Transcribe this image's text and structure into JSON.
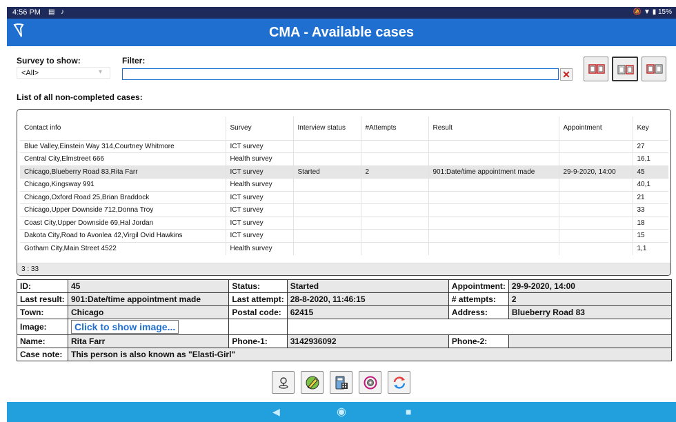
{
  "status_bar": {
    "time": "4:56 PM",
    "icons": [
      "gallery-icon",
      "music-icon"
    ],
    "right": "🔕 ▼ ▮ 15%"
  },
  "header": {
    "title": "CMA - Available cases"
  },
  "survey": {
    "label": "Survey to show:",
    "selected": "<All>"
  },
  "filter": {
    "label": "Filter:",
    "value": "",
    "clear_label": "✕"
  },
  "list": {
    "title": "List of all non-completed cases:",
    "columns": [
      "Contact info",
      "Survey",
      "Interview status",
      "#Attempts",
      "Result",
      "Appointment",
      "Key"
    ],
    "rows": [
      [
        "Blue Valley,Einstein Way 314,Courtney Whitmore",
        "ICT survey",
        "",
        "",
        "",
        "",
        "27"
      ],
      [
        "Central City,Elmstreet 666",
        "Health survey",
        "",
        "",
        "",
        "",
        "16,1"
      ],
      [
        "Chicago,Blueberry Road 83,Rita Farr",
        "ICT survey",
        "Started",
        "2",
        "901:Date/time appointment made",
        "29-9-2020, 14:00",
        "45"
      ],
      [
        "Chicago,Kingsway 991",
        "Health survey",
        "",
        "",
        "",
        "",
        "40,1"
      ],
      [
        "Chicago,Oxford Road 25,Brian Braddock",
        "ICT survey",
        "",
        "",
        "",
        "",
        "21"
      ],
      [
        "Chicago,Upper Downside 712,Donna Troy",
        "ICT survey",
        "",
        "",
        "",
        "",
        "33"
      ],
      [
        "Coast City,Upper Downside 69,Hal Jordan",
        "ICT survey",
        "",
        "",
        "",
        "",
        "18"
      ],
      [
        "Dakota City,Road to Avonlea 42,Virgil Ovid Hawkins",
        "ICT survey",
        "",
        "",
        "",
        "",
        "15"
      ],
      [
        "Gotham City,Main Street 4522",
        "Health survey",
        "",
        "",
        "",
        "",
        "1,1"
      ]
    ],
    "selected_row": 2,
    "count": "3 : 33"
  },
  "details": {
    "id_label": "ID:",
    "id": "45",
    "status_label": "Status:",
    "status": "Started",
    "appointment_label": "Appointment:",
    "appointment": "29-9-2020, 14:00",
    "last_result_label": "Last result:",
    "last_result": "901:Date/time appointment made",
    "last_attempt_label": "Last attempt:",
    "last_attempt": "28-8-2020, 11:46:15",
    "attempts_label": "# attempts:",
    "attempts": "2",
    "town_label": "Town:",
    "town": "Chicago",
    "postal_label": "Postal code:",
    "postal": "62415",
    "address_label": "Address:",
    "address": "Blueberry Road 83",
    "image_label": "Image:",
    "image_link": "Click to show image...",
    "name_label": "Name:",
    "name": "Rita Farr",
    "phone1_label": "Phone-1:",
    "phone1": "3142936092",
    "phone2_label": "Phone-2:",
    "phone2": "",
    "note_label": "Case note:",
    "note": "This person is also known as \"Elasti-Girl\""
  },
  "actions": [
    "map-pin-icon",
    "edit-survey-icon",
    "calculator-icon",
    "settings-cycle-icon",
    "sync-icon"
  ],
  "colors": {
    "header": "#1f6fd1",
    "status_bar": "#1d2a5a",
    "nav_bar": "#22a0dd",
    "accent_red": "#c62020"
  }
}
